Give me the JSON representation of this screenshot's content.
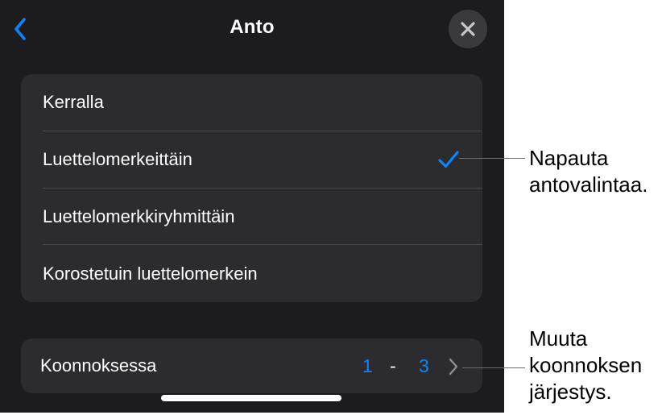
{
  "header": {
    "title": "Anto",
    "back_icon": "chevron-left-icon",
    "close_icon": "close-icon"
  },
  "options": [
    {
      "label": "Kerralla",
      "selected": false
    },
    {
      "label": "Luettelomerkeittäin",
      "selected": true
    },
    {
      "label": "Luettelomerkkiryhmittäin",
      "selected": false
    },
    {
      "label": "Korostetuin luettelomerkein",
      "selected": false
    }
  ],
  "build_order": {
    "label": "Koonnoksessa",
    "from": "1",
    "separator": "-",
    "to": "3",
    "chevron_icon": "chevron-right-icon"
  },
  "callouts": {
    "animation": {
      "line1": "Napauta",
      "line2": "antovalintaa."
    },
    "order": {
      "line1": "Muuta",
      "line2": "koonnoksen",
      "line3": "järjestys."
    }
  },
  "colors": {
    "background": "#1c1c1e",
    "group": "#2c2c2e",
    "accent": "#0a84ff",
    "text": "#ffffff",
    "close_button": "#3a3a3c"
  }
}
